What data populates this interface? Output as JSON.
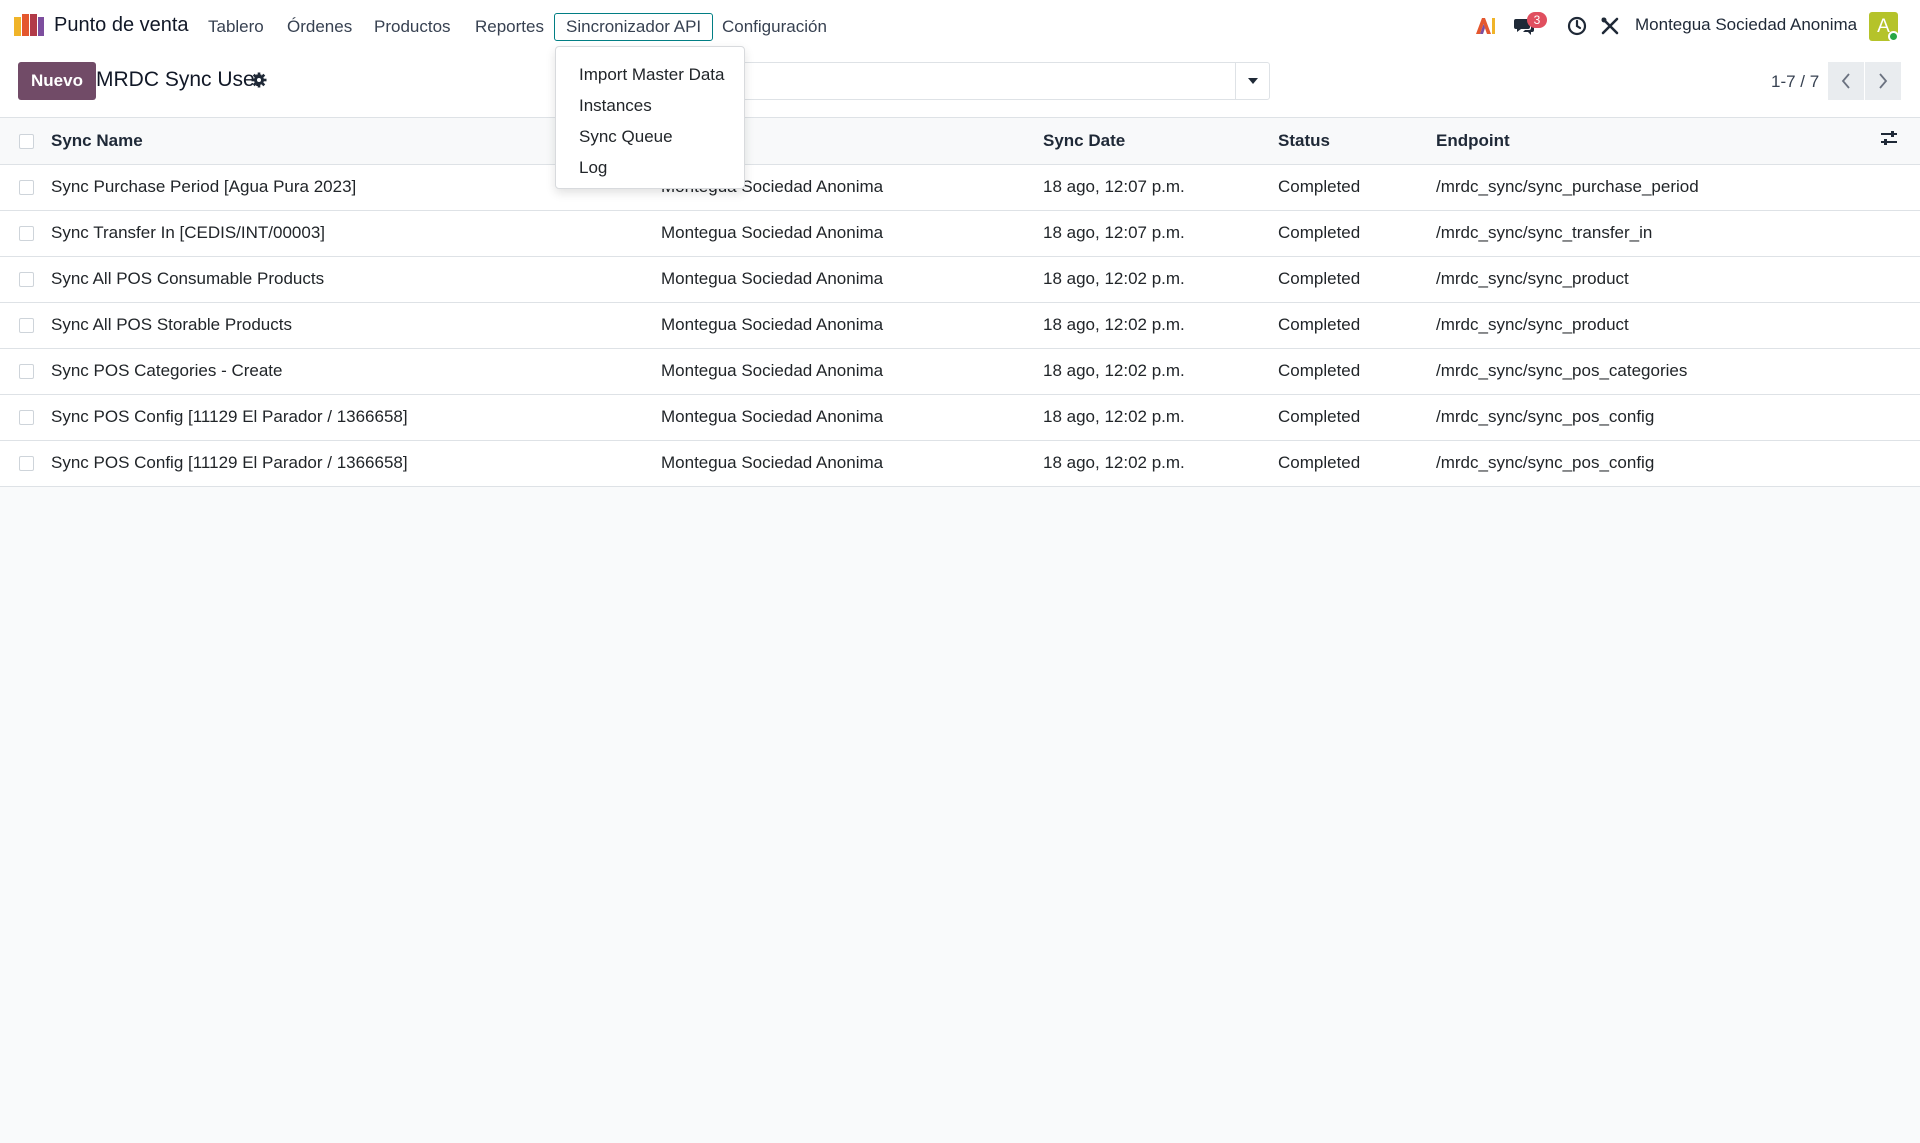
{
  "navbar": {
    "app_name": "Punto de venta",
    "menu": [
      {
        "label": "Tablero"
      },
      {
        "label": "Órdenes"
      },
      {
        "label": "Productos"
      },
      {
        "label": "Reportes"
      },
      {
        "label": "Sincronizador API",
        "active": true
      },
      {
        "label": "Configuración"
      }
    ],
    "messages_badge": "3",
    "company": "Montegua Sociedad Anonima",
    "avatar_initial": "A",
    "icons": [
      "ai-assistant-icon",
      "chat-icon",
      "clock-icon",
      "debug-tools-icon"
    ]
  },
  "control_panel": {
    "new_button": "Nuevo",
    "title": "MRDC Sync User",
    "search_value": ".",
    "pager": "1-7 / 7"
  },
  "dropdown": {
    "items": [
      "Import Master Data",
      "Instances",
      "Sync Queue",
      "Log"
    ]
  },
  "table": {
    "headers": {
      "name": "Sync Name",
      "company": "",
      "date": "Sync Date",
      "status": "Status",
      "endpoint": "Endpoint"
    },
    "rows": [
      {
        "name": "Sync Purchase Period [Agua Pura 2023]",
        "company": "Montegua Sociedad Anonima",
        "date": "18 ago, 12:07 p.m.",
        "status": "Completed",
        "endpoint": "/mrdc_sync/sync_purchase_period"
      },
      {
        "name": "Sync Transfer In [CEDIS/INT/00003]",
        "company": "Montegua Sociedad Anonima",
        "date": "18 ago, 12:07 p.m.",
        "status": "Completed",
        "endpoint": "/mrdc_sync/sync_transfer_in"
      },
      {
        "name": "Sync All POS Consumable Products",
        "company": "Montegua Sociedad Anonima",
        "date": "18 ago, 12:02 p.m.",
        "status": "Completed",
        "endpoint": "/mrdc_sync/sync_product"
      },
      {
        "name": "Sync All POS Storable Products",
        "company": "Montegua Sociedad Anonima",
        "date": "18 ago, 12:02 p.m.",
        "status": "Completed",
        "endpoint": "/mrdc_sync/sync_product"
      },
      {
        "name": "Sync POS Categories - Create",
        "company": "Montegua Sociedad Anonima",
        "date": "18 ago, 12:02 p.m.",
        "status": "Completed",
        "endpoint": "/mrdc_sync/sync_pos_categories"
      },
      {
        "name": "Sync POS Config [11129 El Parador / 1366658]",
        "company": "Montegua Sociedad Anonima",
        "date": "18 ago, 12:02 p.m.",
        "status": "Completed",
        "endpoint": "/mrdc_sync/sync_pos_config"
      },
      {
        "name": "Sync POS Config [11129 El Parador / 1366658]",
        "company": "Montegua Sociedad Anonima",
        "date": "18 ago, 12:02 p.m.",
        "status": "Completed",
        "endpoint": "/mrdc_sync/sync_pos_config"
      }
    ]
  },
  "colors": {
    "brand": "#714b67",
    "active_menu_border": "#017e84",
    "badge": "#e04f5f",
    "avatar": "#b5c32a"
  }
}
